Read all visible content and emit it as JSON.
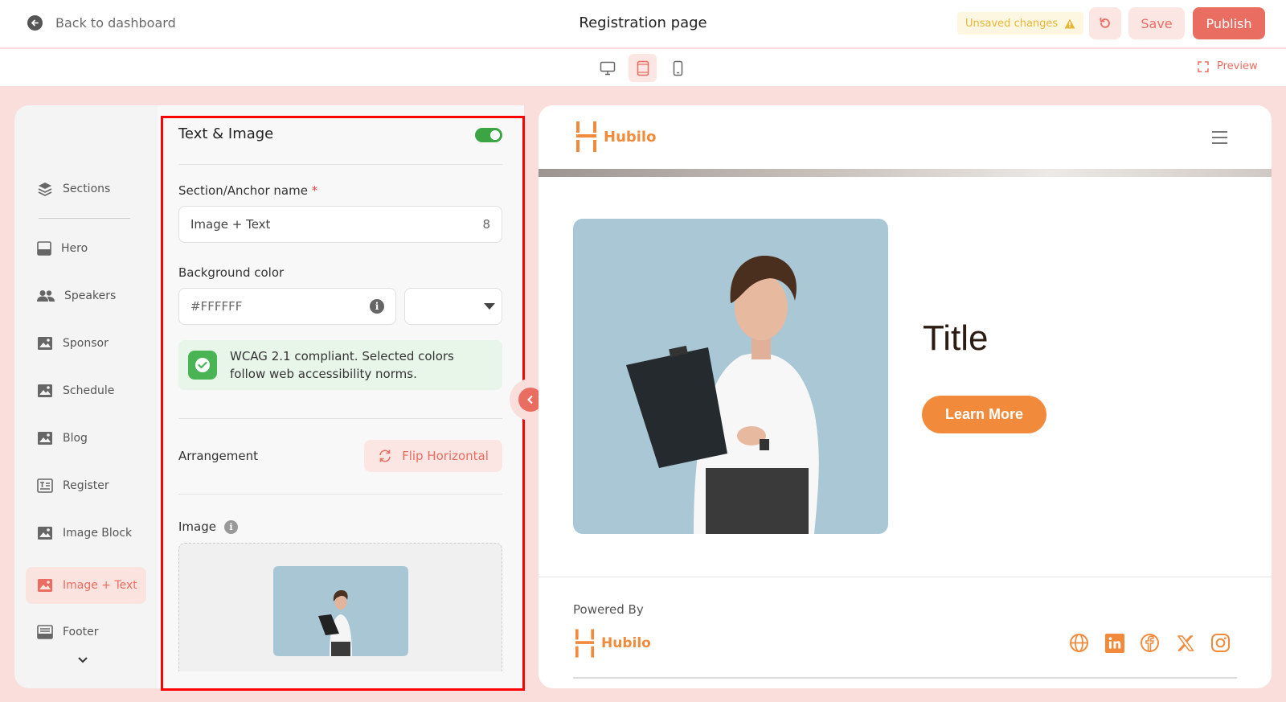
{
  "header": {
    "back_label": "Back to dashboard",
    "title": "Registration page",
    "unsaved_label": "Unsaved changes",
    "save_label": "Save",
    "publish_label": "Publish"
  },
  "device_bar": {
    "devices": [
      "desktop",
      "tablet",
      "mobile"
    ],
    "active_device": "tablet",
    "preview_label": "Preview"
  },
  "sidebar": {
    "items": [
      {
        "label": "Sections",
        "icon": "layers-icon"
      },
      {
        "label": "Hero",
        "icon": "hero-icon"
      },
      {
        "label": "Speakers",
        "icon": "users-icon"
      },
      {
        "label": "Sponsor",
        "icon": "image-icon"
      },
      {
        "label": "Schedule",
        "icon": "image-icon"
      },
      {
        "label": "Blog",
        "icon": "image-icon"
      },
      {
        "label": "Register",
        "icon": "register-icon"
      },
      {
        "label": "Image Block",
        "icon": "image-icon"
      },
      {
        "label": "Image + Text",
        "icon": "image-icon",
        "active": true
      },
      {
        "label": "Footer",
        "icon": "footer-icon"
      }
    ]
  },
  "panel": {
    "title": "Text & Image",
    "enabled": true,
    "anchor_label": "Section/Anchor name",
    "anchor_required": "*",
    "anchor_value": "Image + Text",
    "anchor_counter": "8",
    "bg_label": "Background color",
    "bg_value": "#FFFFFF",
    "wcag_text": "WCAG 2.1 compliant. Selected colors follow web accessibility norms.",
    "arrangement_label": "Arrangement",
    "flip_label": "Flip Horizontal",
    "image_label": "Image"
  },
  "canvas": {
    "brand": "Hubilo",
    "title": "Title",
    "cta_label": "Learn More",
    "powered_by": "Powered By",
    "footer_brand": "Hubilo",
    "socials": [
      "globe-icon",
      "linkedin-icon",
      "facebook-icon",
      "x-icon",
      "instagram-icon"
    ]
  },
  "colors": {
    "accent": "#EA6D62",
    "brand_orange": "#F28A3B",
    "toggle_on": "#3BA544",
    "success_bg": "#E8F5E9"
  }
}
